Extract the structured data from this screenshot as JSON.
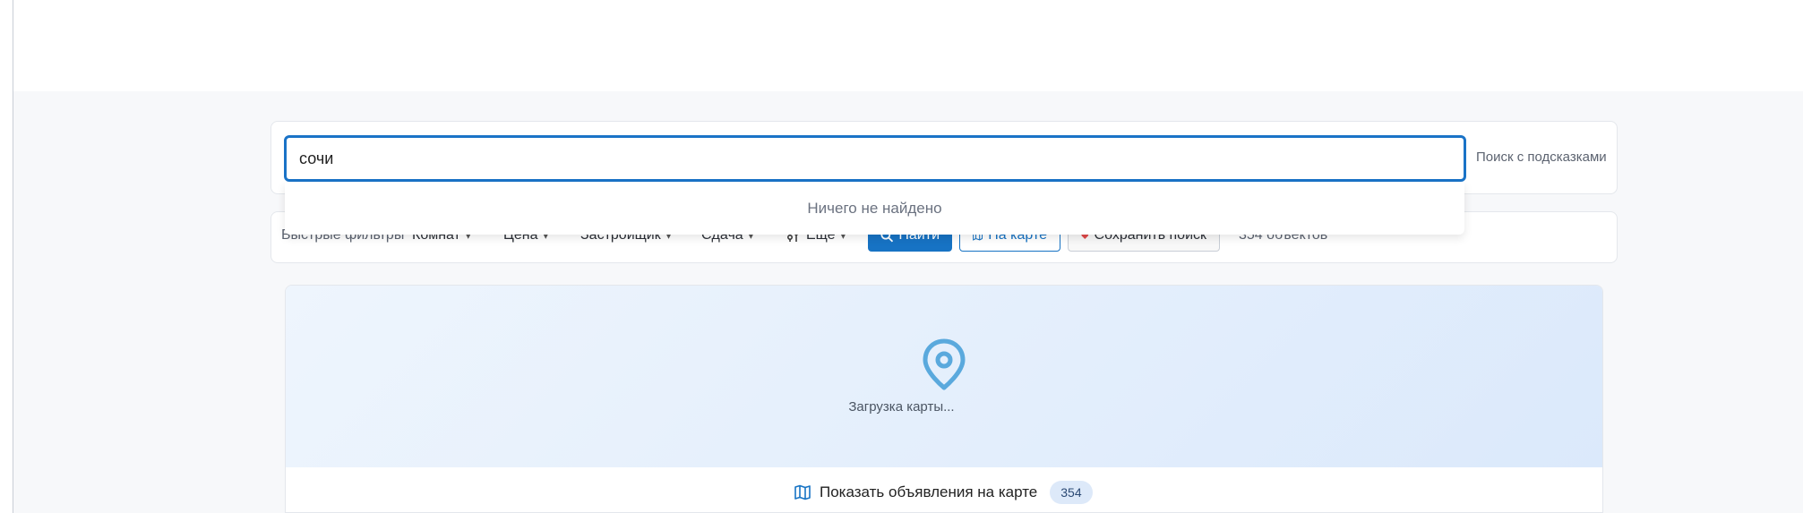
{
  "search": {
    "value": "сочи",
    "hint": "Поиск с подсказками",
    "empty_result": "Ничего не найдено"
  },
  "filters": {
    "label": "Быстрые фильтры",
    "rooms": "Комнат",
    "price": "Цена",
    "developer": "Застройщик",
    "delivery": "Сдача",
    "more": "Еще"
  },
  "actions": {
    "find": "Найти",
    "on_map": "На карте",
    "save_search": "Сохранить поиск"
  },
  "results": {
    "count_text": "354 объектов"
  },
  "map": {
    "loading": "Загрузка карты...",
    "show_label": "Показать объявления на карте",
    "badge": "354"
  },
  "colors": {
    "accent": "#1773c4",
    "pin": "#5aa9dd",
    "heart": "#e04848"
  }
}
